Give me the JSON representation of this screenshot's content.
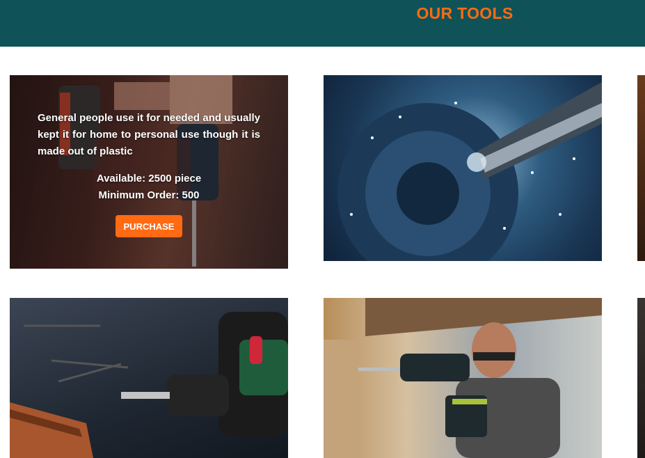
{
  "header": {
    "title": "OUR TOOLS"
  },
  "products": [
    {
      "description": "General people use it for needed and usually kept it for home to personal use though it is made out of plastic",
      "available": "Available: 2500 piece",
      "minimum_order": "Minimum Order: 500",
      "button": "PURCHASE"
    }
  ],
  "images": [
    "cordless-drill-in-hand",
    "lathe-chuck-cutting",
    "drill-with-screws-on-table",
    "worker-using-drill",
    "partial-tool-image",
    "partial-tool-image"
  ],
  "colors": {
    "header_bg": "#0f5358",
    "accent": "#ff6a13",
    "page_bg": "#ffffff"
  }
}
